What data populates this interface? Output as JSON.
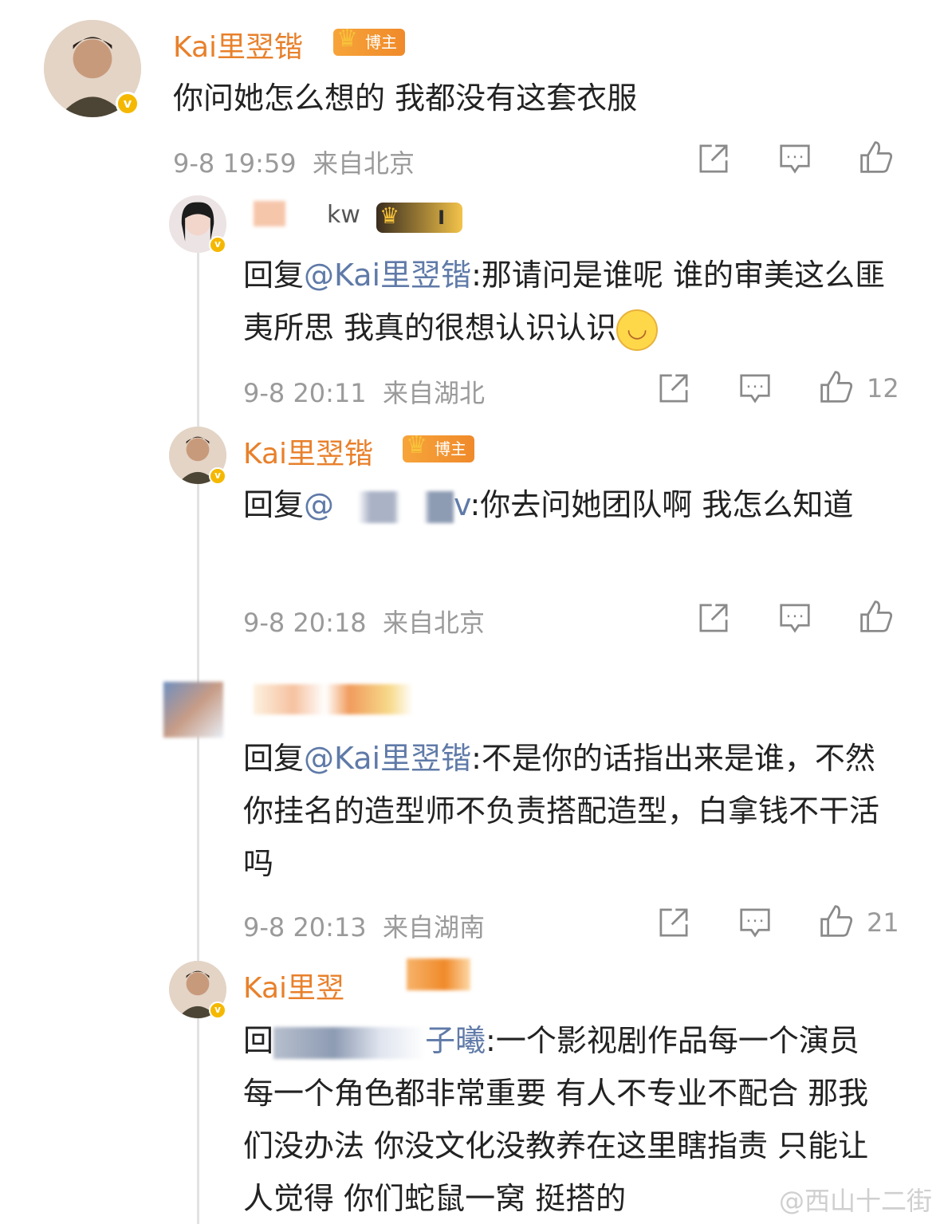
{
  "comments": [
    {
      "name": "Kai里翌锴",
      "badge": "博主",
      "text": "你问她怎么想的 我都没有这套衣服",
      "time": "9-8 19:59",
      "location": "来自北京"
    },
    {
      "name": "kw",
      "badge": "I",
      "reply_prefix": "回复",
      "mention": "@Kai里翌锴",
      "text": ":那请问是谁呢 谁的审美这么匪夷所思 我真的很想认识认识",
      "time": "9-8 20:11",
      "location": "来自湖北",
      "likes": "12"
    },
    {
      "name": "Kai里翌锴",
      "badge": "博主",
      "reply_prefix": "回复",
      "mention": "@",
      "mention_tail": "v",
      "text": ":你去问她团队啊 我怎么知道",
      "time": "9-8 20:18",
      "location": "来自北京"
    },
    {
      "reply_prefix": "回复",
      "mention": "@Kai里翌锴",
      "text": ":不是你的话指出来是谁，不然你挂名的造型师不负责搭配造型，白拿钱不干活吗",
      "time": "9-8 20:13",
      "location": "来自湖南",
      "likes": "21"
    },
    {
      "name": "Kai里翌",
      "reply_prefix": "回",
      "mention_tail": "子曦",
      "text": ":一个影视剧作品每一个演员 每一个角色都非常重要 有人不专业不配合 那我们没办法 你没文化没教养在这里瞎指责 只能让人觉得 你们蛇鼠一窝 挺搭的"
    }
  ],
  "watermark": "@西山十二街",
  "icons": [
    "share-icon",
    "comment-icon",
    "like-icon",
    "verified-icon",
    "crown-icon"
  ],
  "colors": {
    "name": "#e8802b",
    "mention": "#5f7aa8",
    "meta": "#9a9a9a",
    "badge": "#f08a2a"
  }
}
